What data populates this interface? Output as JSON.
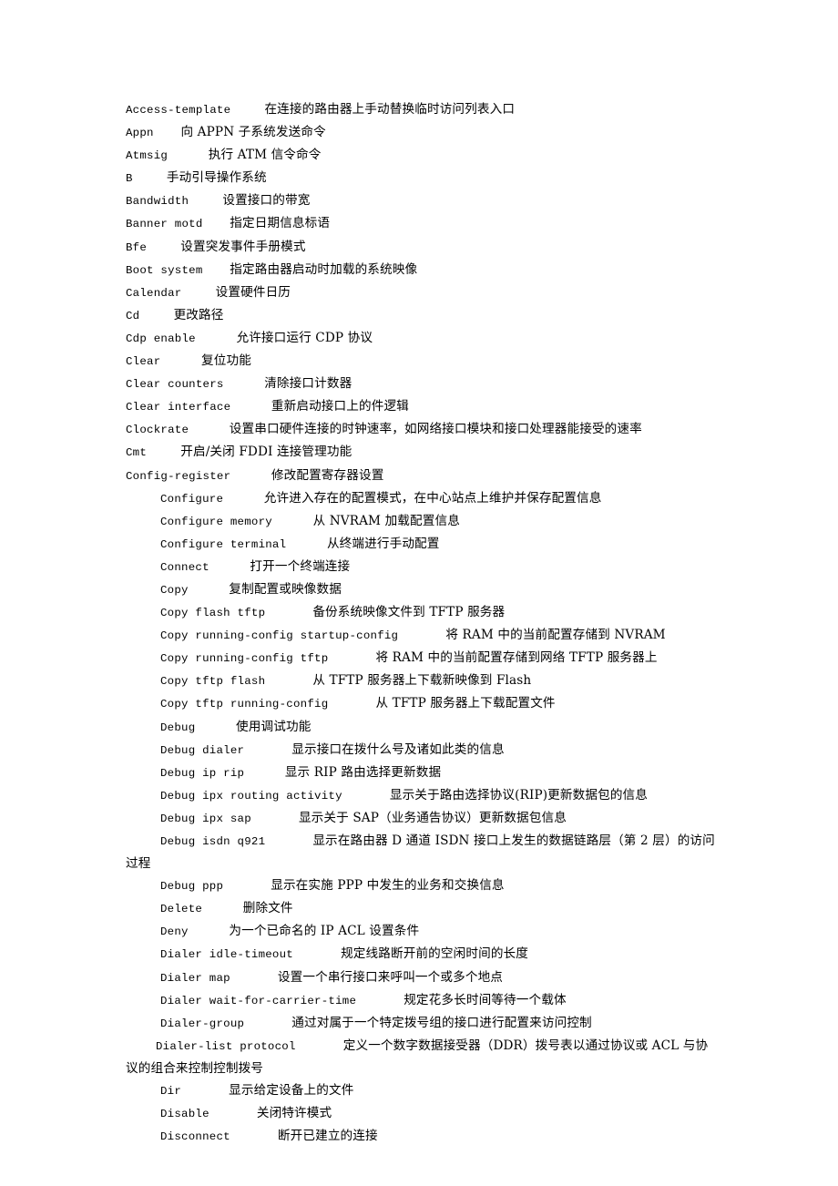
{
  "document": {
    "type": "reference-list",
    "language": "zh-CN",
    "description": "Cisco IOS router command reference list with Chinese descriptions",
    "entries": [
      {
        "level": 0,
        "command": "Access-template",
        "gap": "     ",
        "description": "在连接的路由器上手动替换临时访问列表入口"
      },
      {
        "level": 0,
        "command": "Appn",
        "gap": "    ",
        "description": "向 APPN 子系统发送命令"
      },
      {
        "level": 0,
        "command": "Atmsig",
        "gap": "      ",
        "description": "执行 ATM 信令命令"
      },
      {
        "level": 0,
        "command": "B",
        "gap": "     ",
        "description": "手动引导操作系统"
      },
      {
        "level": 0,
        "command": "Bandwidth",
        "gap": "     ",
        "description": "设置接口的带宽"
      },
      {
        "level": 0,
        "command": "Banner motd",
        "gap": "    ",
        "description": "指定日期信息标语"
      },
      {
        "level": 0,
        "command": "Bfe",
        "gap": "     ",
        "description": "设置突发事件手册模式"
      },
      {
        "level": 0,
        "command": "Boot system",
        "gap": "    ",
        "description": "指定路由器启动时加载的系统映像"
      },
      {
        "level": 0,
        "command": "Calendar",
        "gap": "     ",
        "description": "设置硬件日历"
      },
      {
        "level": 0,
        "command": "Cd",
        "gap": "     ",
        "description": "更改路径"
      },
      {
        "level": 0,
        "command": "Cdp enable",
        "gap": "      ",
        "description": "允许接口运行 CDP 协议"
      },
      {
        "level": 0,
        "command": "Clear",
        "gap": "      ",
        "description": "复位功能"
      },
      {
        "level": 0,
        "command": "Clear counters",
        "gap": "      ",
        "description": "清除接口计数器"
      },
      {
        "level": 0,
        "command": "Clear interface",
        "gap": "      ",
        "description": "重新启动接口上的件逻辑"
      },
      {
        "level": 0,
        "command": "Clockrate",
        "gap": "      ",
        "description": "设置串口硬件连接的时钟速率，如网络接口模块和接口处理器能接受的速率"
      },
      {
        "level": 0,
        "command": "Cmt",
        "gap": "     ",
        "description": "开启/关闭 FDDI 连接管理功能"
      },
      {
        "level": 0,
        "command": "Config-register",
        "gap": "      ",
        "description": "修改配置寄存器设置"
      },
      {
        "level": 1,
        "command": "Configure",
        "gap": "      ",
        "description": "允许进入存在的配置模式，在中心站点上维护并保存配置信息"
      },
      {
        "level": 1,
        "command": "Configure memory",
        "gap": "      ",
        "description": "从 NVRAM 加载配置信息"
      },
      {
        "level": 1,
        "command": "Configure terminal",
        "gap": "      ",
        "description": "从终端进行手动配置"
      },
      {
        "level": 1,
        "command": "Connect",
        "gap": "      ",
        "description": "打开一个终端连接"
      },
      {
        "level": 1,
        "command": "Copy",
        "gap": "      ",
        "description": "复制配置或映像数据"
      },
      {
        "level": 1,
        "command": "Copy flash tftp",
        "gap": "       ",
        "description": "备份系统映像文件到 TFTP 服务器"
      },
      {
        "level": 1,
        "command": "Copy running-config startup-config",
        "gap": "       ",
        "description": "将 RAM 中的当前配置存储到 NVRAM"
      },
      {
        "level": 1,
        "command": "Copy running-config tftp",
        "gap": "       ",
        "description": "将 RAM 中的当前配置存储到网络 TFTP 服务器上"
      },
      {
        "level": 1,
        "command": "Copy tftp flash",
        "gap": "       ",
        "description": "从 TFTP 服务器上下载新映像到 Flash"
      },
      {
        "level": 1,
        "command": "Copy tftp running-config",
        "gap": "       ",
        "description": "从 TFTP 服务器上下载配置文件"
      },
      {
        "level": 1,
        "command": "Debug",
        "gap": "      ",
        "description": "使用调试功能"
      },
      {
        "level": 1,
        "command": "Debug dialer",
        "gap": "       ",
        "description": "显示接口在拨什么号及诸如此类的信息"
      },
      {
        "level": 1,
        "command": "Debug ip rip",
        "gap": "      ",
        "description": "显示 RIP 路由选择更新数据"
      },
      {
        "level": 1,
        "command": "Debug ipx routing activity",
        "gap": "       ",
        "description": "显示关于路由选择协议(RIP)更新数据包的信息"
      },
      {
        "level": 1,
        "command": "Debug ipx sap",
        "gap": "       ",
        "description": "显示关于 SAP（业务通告协议）更新数据包信息"
      },
      {
        "level": 1,
        "command": "Debug isdn q921",
        "gap": "       ",
        "description": "显示在路由器 D 通道 ISDN 接口上发生的数据链路层（第 2 层）的访问过程"
      },
      {
        "level": 1,
        "command": "Debug ppp",
        "gap": "       ",
        "description": "显示在实施 PPP 中发生的业务和交换信息"
      },
      {
        "level": 1,
        "command": "Delete",
        "gap": "      ",
        "description": "删除文件"
      },
      {
        "level": 1,
        "command": "Deny",
        "gap": "      ",
        "description": "为一个已命名的 IP  ACL 设置条件"
      },
      {
        "level": 1,
        "command": "Dialer idle-timeout",
        "gap": "       ",
        "description": "规定线路断开前的空闲时间的长度"
      },
      {
        "level": 1,
        "command": "Dialer map",
        "gap": "       ",
        "description": "设置一个串行接口来呼叫一个或多个地点"
      },
      {
        "level": 1,
        "command": "Dialer wait-for-carrier-time",
        "gap": "       ",
        "description": "规定花多长时间等待一个载体"
      },
      {
        "level": 1,
        "command": "Dialer-group",
        "gap": "       ",
        "description": "通过对属于一个特定拨号组的接口进行配置来访问控制"
      },
      {
        "level": 2,
        "command": "Dialer-list protocol",
        "gap": "       ",
        "description": "定义一个数字数据接受器（DDR）拨号表以通过协议或 ACL 与协议的组合来控制控制拨号"
      },
      {
        "level": 1,
        "command": "Dir",
        "gap": "       ",
        "description": "显示给定设备上的文件"
      },
      {
        "level": 1,
        "command": "Disable",
        "gap": "       ",
        "description": "关闭特许模式"
      },
      {
        "level": 1,
        "command": "Disconnect",
        "gap": "       ",
        "description": "断开已建立的连接"
      }
    ]
  }
}
